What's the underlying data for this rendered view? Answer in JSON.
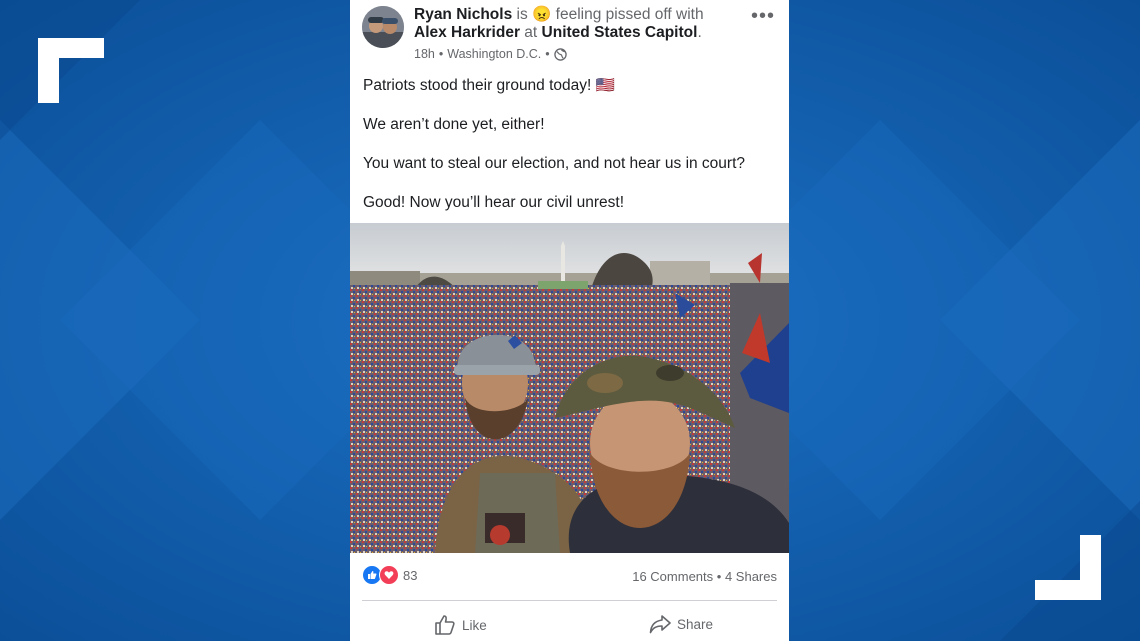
{
  "post": {
    "author": "Ryan Nichols",
    "is_word": "is",
    "feeling_emoji": "😠",
    "feeling_text": "feeling pissed off with",
    "tagged_user": "Alex Harkrider",
    "at_word": "at",
    "location": "United States Capitol",
    "period": ".",
    "time": "18h",
    "place": "Washington D.C.",
    "dot": "•",
    "privacy_icon": "globe-icon",
    "more_icon": "•••",
    "lines": [
      "Patriots stood their ground today! 🇺🇸",
      "We aren’t done yet, either!",
      "You want to steal our election, and not hear us in court?",
      "Good! Now you’ll hear our civil unrest!"
    ],
    "reaction_count": "83",
    "comments": "16 Comments",
    "shares": "4 Shares",
    "like_label": "Like",
    "share_label": "Share"
  },
  "colors": {
    "like_blue": "#1877f2",
    "love_red": "#f33e58",
    "background_blue": "#1563b3"
  }
}
